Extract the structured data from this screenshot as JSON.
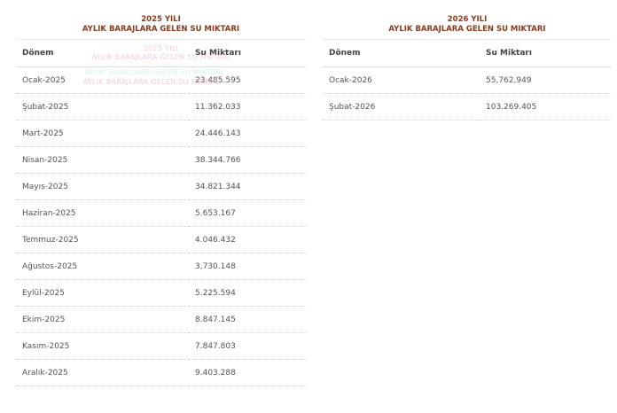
{
  "panels": [
    {
      "title_line1": "2025 YILI",
      "title_line2": "AYLIK BARAJLARA GELEN SU MIKTARI",
      "columns": [
        "Dönem",
        "Su Miktarı"
      ],
      "rows": [
        {
          "period": "Ocak-2025",
          "amount": "23.485.595"
        },
        {
          "period": "Şubat-2025",
          "amount": "11.362.033"
        },
        {
          "period": "Mart-2025",
          "amount": "24.446.143"
        },
        {
          "period": "Nisan-2025",
          "amount": "38.344.766"
        },
        {
          "period": "Mayıs-2025",
          "amount": "34.821.344"
        },
        {
          "period": "Haziran-2025",
          "amount": "5.653.167"
        },
        {
          "period": "Temmuz-2025",
          "amount": "4.046.432"
        },
        {
          "period": "Ağustos-2025",
          "amount": "3,730.148"
        },
        {
          "period": "Eylül-2025",
          "amount": "5.225.594"
        },
        {
          "period": "Ekim-2025",
          "amount": "8.847.145"
        },
        {
          "period": "Kasım-2025",
          "amount": "7.847.803"
        },
        {
          "period": "Aralık-2025",
          "amount": "9.403.288"
        }
      ]
    },
    {
      "title_line1": "2026 YILI",
      "title_line2": "AYLIK BARAJLARA GELEN SU MIKTARI",
      "columns": [
        "Dönem",
        "Su Miktarı"
      ],
      "rows": [
        {
          "period": "Ocak-2026",
          "amount": "55,762,949"
        },
        {
          "period": "Şubat-2026",
          "amount": "103.269.405"
        }
      ]
    }
  ],
  "ghost_text": {
    "year": "2025 YILI",
    "subtitle": "AYLIK BARAJLARA GELEN SU MIKTARI"
  },
  "colors": {
    "title": "#8b3a1a",
    "text": "#555555",
    "header_text": "#444444",
    "ghost_pink": "#f0a0c8",
    "ghost_cyan": "#9fe6ef"
  }
}
